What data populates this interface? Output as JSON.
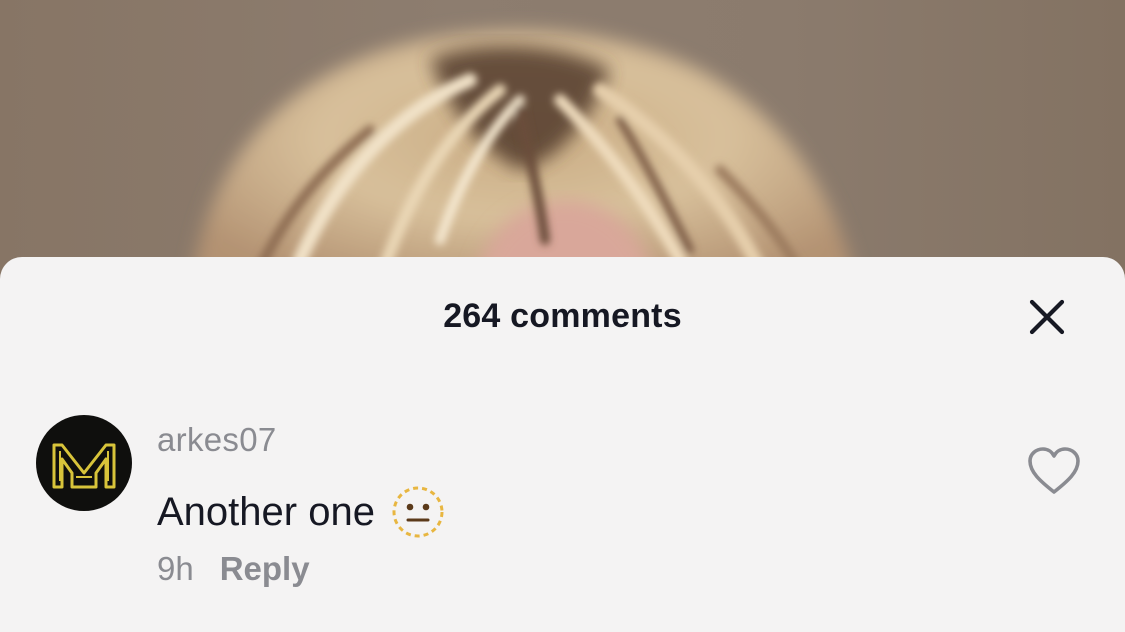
{
  "sheet": {
    "title": "264 comments",
    "close_icon": "close-icon"
  },
  "comment": {
    "username": "arkes07",
    "text": "Another one",
    "emoji": "neutral-face-emoji",
    "time": "9h",
    "reply_label": "Reply",
    "avatar_icon": "m-logo-avatar",
    "like_icon": "heart-outline-icon"
  },
  "colors": {
    "sheet_bg": "#f4f3f3",
    "primary_text": "#161823",
    "secondary_text": "#8a8b91",
    "avatar_accent": "#d8c43a"
  }
}
